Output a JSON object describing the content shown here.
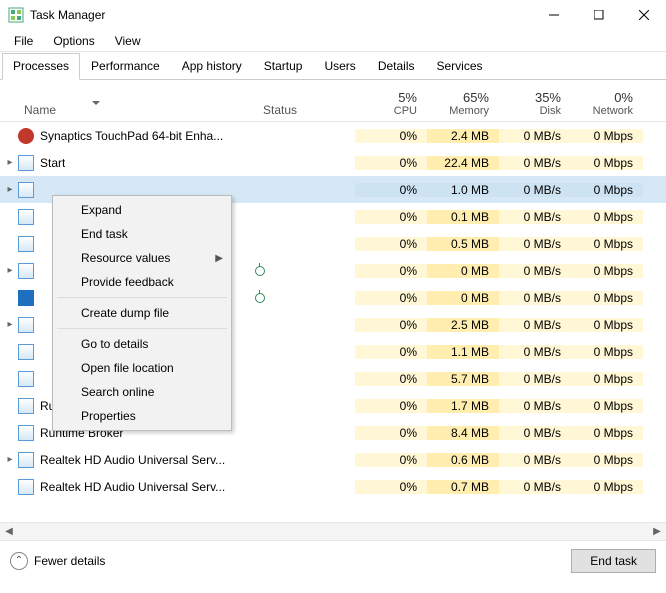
{
  "window": {
    "title": "Task Manager"
  },
  "menu": {
    "file": "File",
    "options": "Options",
    "view": "View"
  },
  "tabs": {
    "processes": "Processes",
    "performance": "Performance",
    "app_history": "App history",
    "startup": "Startup",
    "users": "Users",
    "details": "Details",
    "services": "Services"
  },
  "columns": {
    "name": "Name",
    "status": "Status",
    "cpu": {
      "pct": "5%",
      "label": "CPU"
    },
    "memory": {
      "pct": "65%",
      "label": "Memory"
    },
    "disk": {
      "pct": "35%",
      "label": "Disk"
    },
    "network": {
      "pct": "0%",
      "label": "Network"
    }
  },
  "rows": [
    {
      "name": "Synaptics TouchPad 64-bit Enha...",
      "expand": false,
      "icon": "red",
      "leaf": false,
      "cpu": "0%",
      "mem": "2.4 MB",
      "disk": "0 MB/s",
      "net": "0 Mbps"
    },
    {
      "name": "Start",
      "expand": true,
      "icon": "std",
      "leaf": false,
      "cpu": "0%",
      "mem": "22.4 MB",
      "disk": "0 MB/s",
      "net": "0 Mbps"
    },
    {
      "name": "",
      "expand": true,
      "icon": "std",
      "leaf": false,
      "cpu": "0%",
      "mem": "1.0 MB",
      "disk": "0 MB/s",
      "net": "0 Mbps",
      "selected": true
    },
    {
      "name": "",
      "expand": false,
      "icon": "std",
      "leaf": false,
      "cpu": "0%",
      "mem": "0.1 MB",
      "disk": "0 MB/s",
      "net": "0 Mbps"
    },
    {
      "name": "",
      "expand": false,
      "icon": "std",
      "leaf": false,
      "cpu": "0%",
      "mem": "0.5 MB",
      "disk": "0 MB/s",
      "net": "0 Mbps"
    },
    {
      "name": "",
      "expand": true,
      "icon": "std",
      "leaf": true,
      "cpu": "0%",
      "mem": "0 MB",
      "disk": "0 MB/s",
      "net": "0 Mbps"
    },
    {
      "name": "",
      "expand": false,
      "icon": "blue",
      "leaf": true,
      "cpu": "0%",
      "mem": "0 MB",
      "disk": "0 MB/s",
      "net": "0 Mbps"
    },
    {
      "name": "",
      "expand": true,
      "icon": "std",
      "leaf": false,
      "cpu": "0%",
      "mem": "2.5 MB",
      "disk": "0 MB/s",
      "net": "0 Mbps"
    },
    {
      "name": "",
      "expand": false,
      "icon": "std",
      "leaf": false,
      "cpu": "0%",
      "mem": "1.1 MB",
      "disk": "0 MB/s",
      "net": "0 Mbps"
    },
    {
      "name": "",
      "expand": false,
      "icon": "std",
      "leaf": false,
      "cpu": "0%",
      "mem": "5.7 MB",
      "disk": "0 MB/s",
      "net": "0 Mbps"
    },
    {
      "name": "Runtime Broker",
      "expand": false,
      "icon": "std",
      "leaf": false,
      "cpu": "0%",
      "mem": "1.7 MB",
      "disk": "0 MB/s",
      "net": "0 Mbps"
    },
    {
      "name": "Runtime Broker",
      "expand": false,
      "icon": "std",
      "leaf": false,
      "cpu": "0%",
      "mem": "8.4 MB",
      "disk": "0 MB/s",
      "net": "0 Mbps"
    },
    {
      "name": "Realtek HD Audio Universal Serv...",
      "expand": true,
      "icon": "std",
      "leaf": false,
      "cpu": "0%",
      "mem": "0.6 MB",
      "disk": "0 MB/s",
      "net": "0 Mbps"
    },
    {
      "name": "Realtek HD Audio Universal Serv...",
      "expand": false,
      "icon": "std",
      "leaf": false,
      "cpu": "0%",
      "mem": "0.7 MB",
      "disk": "0 MB/s",
      "net": "0 Mbps"
    }
  ],
  "context_menu": {
    "expand": "Expand",
    "end_task": "End task",
    "resource_values": "Resource values",
    "provide_feedback": "Provide feedback",
    "create_dump": "Create dump file",
    "go_to_details": "Go to details",
    "open_file_location": "Open file location",
    "search_online": "Search online",
    "properties": "Properties"
  },
  "footer": {
    "fewer": "Fewer details",
    "end_task": "End task"
  }
}
